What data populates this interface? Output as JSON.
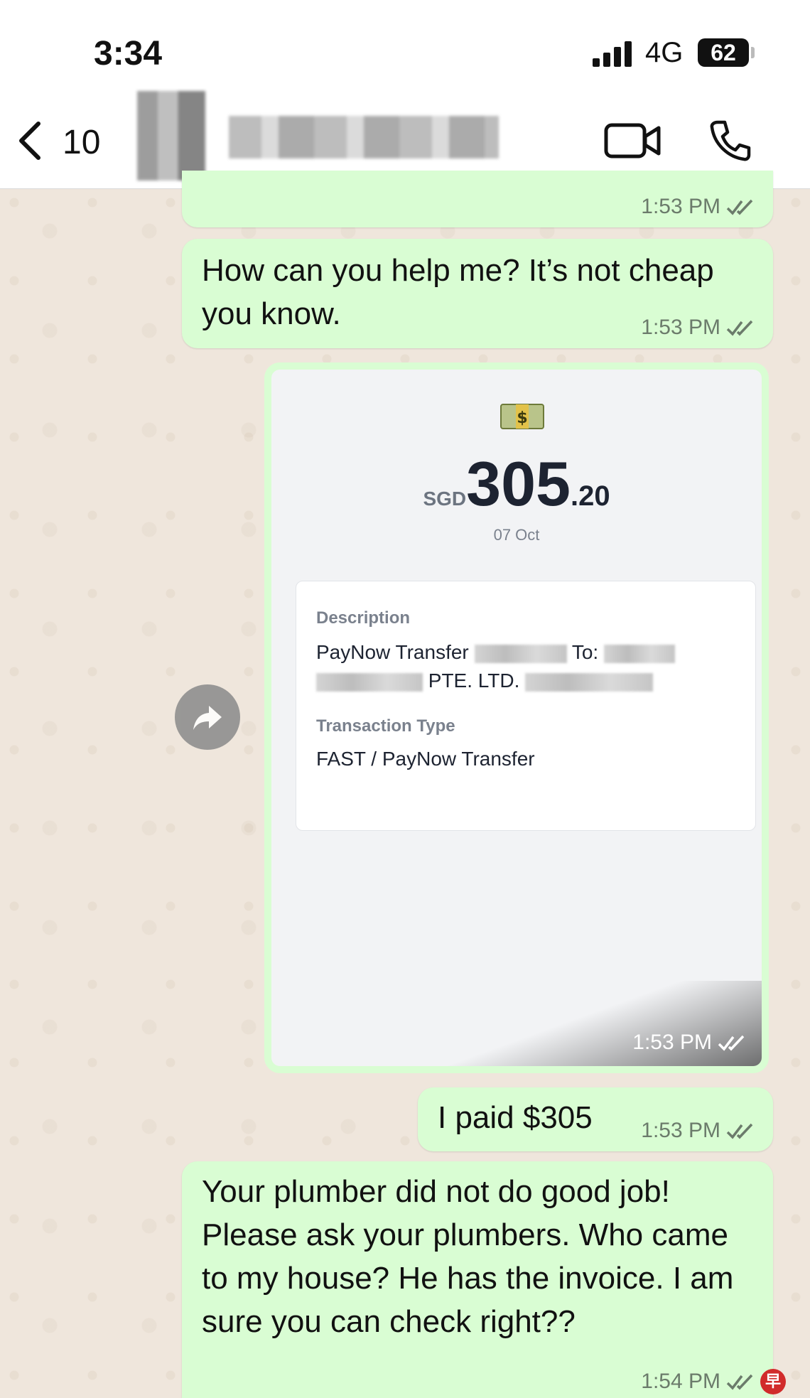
{
  "status_bar": {
    "time": "3:34",
    "network": "4G",
    "battery": "62"
  },
  "header": {
    "back_count": "10",
    "contact_name": ""
  },
  "messages": [
    {
      "text": "",
      "time": "1:53 PM"
    },
    {
      "text": "How can you help me? It’s not cheap you know.",
      "time": "1:53 PM"
    },
    {
      "time": "1:53 PM",
      "receipt": {
        "currency": "SGD",
        "amount": "305",
        "decimals": ".20",
        "date": "07 Oct",
        "description_label": "Description",
        "description_line1": "PayNow Transfer",
        "description_to": "To:",
        "description_line2": "PTE. LTD.",
        "type_label": "Transaction Type",
        "type_value": "FAST / PayNow Transfer"
      }
    },
    {
      "text": "I paid $305",
      "time": "1:53 PM"
    },
    {
      "text": "Your plumber did not do good job! Please ask your plumbers. Who came to my house? He has the invoice. I am sure you can check right??",
      "time": "1:54 PM"
    }
  ],
  "badge": "早",
  "colors": {
    "bubble": "#d9fdd3",
    "wallpaper": "#efe6dc",
    "tick": "#6b7b6b"
  }
}
